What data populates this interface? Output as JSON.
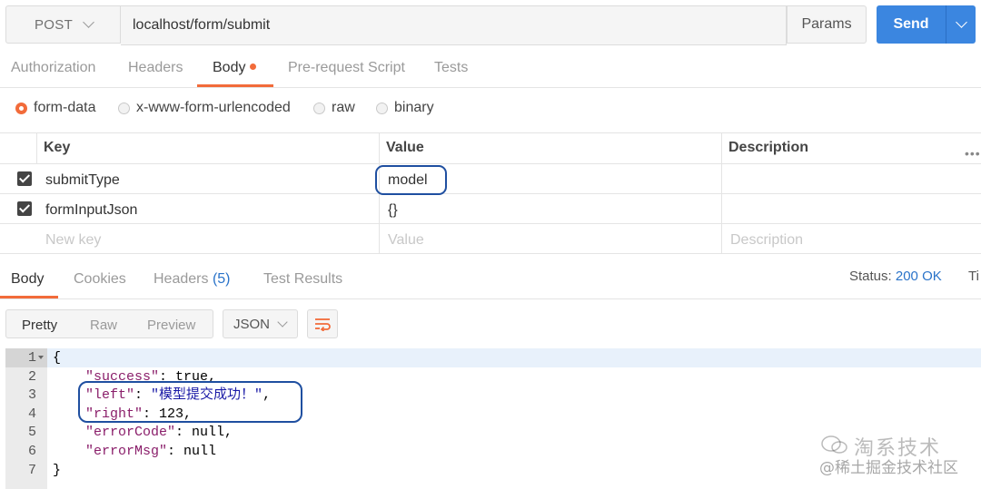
{
  "request": {
    "method": "POST",
    "url": "localhost/form/submit",
    "params_label": "Params",
    "send_label": "Send"
  },
  "request_tabs": [
    {
      "label": "Authorization",
      "active": false
    },
    {
      "label": "Headers",
      "active": false
    },
    {
      "label": "Body",
      "active": true,
      "dot": true
    },
    {
      "label": "Pre-request Script",
      "active": false
    },
    {
      "label": "Tests",
      "active": false
    }
  ],
  "body_types": [
    {
      "label": "form-data",
      "selected": true
    },
    {
      "label": "x-www-form-urlencoded",
      "selected": false
    },
    {
      "label": "raw",
      "selected": false
    },
    {
      "label": "binary",
      "selected": false
    }
  ],
  "kv_table": {
    "headers": [
      "Key",
      "Value",
      "Description"
    ],
    "rows": [
      {
        "checked": true,
        "key": "submitType",
        "value": "model",
        "description": ""
      },
      {
        "checked": true,
        "key": "formInputJson",
        "value": "{}",
        "description": ""
      }
    ],
    "placeholder": {
      "key": "New key",
      "value": "Value",
      "description": "Description"
    }
  },
  "response_tabs": [
    {
      "label": "Body",
      "active": true
    },
    {
      "label": "Cookies",
      "active": false
    },
    {
      "label": "Headers",
      "count": "(5)",
      "active": false
    },
    {
      "label": "Test Results",
      "active": false
    }
  ],
  "status": {
    "label": "Status:",
    "value": "200 OK",
    "time_label_partial": "Ti"
  },
  "format_bar": {
    "modes": [
      "Pretty",
      "Raw",
      "Preview"
    ],
    "active_mode": "Pretty",
    "language": "JSON"
  },
  "code": {
    "line_numbers": [
      "1",
      "2",
      "3",
      "4",
      "5",
      "6",
      "7"
    ],
    "lines": [
      [
        {
          "t": "p",
          "v": "{"
        }
      ],
      [
        {
          "t": "p",
          "v": "    "
        },
        {
          "t": "k",
          "v": "\"success\""
        },
        {
          "t": "p",
          "v": ": true,"
        }
      ],
      [
        {
          "t": "p",
          "v": "    "
        },
        {
          "t": "k",
          "v": "\"left\""
        },
        {
          "t": "p",
          "v": ": "
        },
        {
          "t": "s",
          "v": "\"模型提交成功！\""
        },
        {
          "t": "p",
          "v": ","
        }
      ],
      [
        {
          "t": "p",
          "v": "    "
        },
        {
          "t": "k",
          "v": "\"right\""
        },
        {
          "t": "p",
          "v": ": 123,"
        }
      ],
      [
        {
          "t": "p",
          "v": "    "
        },
        {
          "t": "k",
          "v": "\"errorCode\""
        },
        {
          "t": "p",
          "v": ": null,"
        }
      ],
      [
        {
          "t": "p",
          "v": "    "
        },
        {
          "t": "k",
          "v": "\"errorMsg\""
        },
        {
          "t": "p",
          "v": ": null"
        }
      ],
      [
        {
          "t": "p",
          "v": "}"
        }
      ]
    ]
  },
  "watermark": {
    "line1": "淘系技术",
    "line2": "@稀土掘金技术社区"
  },
  "colors": {
    "accent": "#f26b3a",
    "send": "#3b86e0",
    "highlight": "#1f4fa0",
    "status": "#2a73c9"
  }
}
